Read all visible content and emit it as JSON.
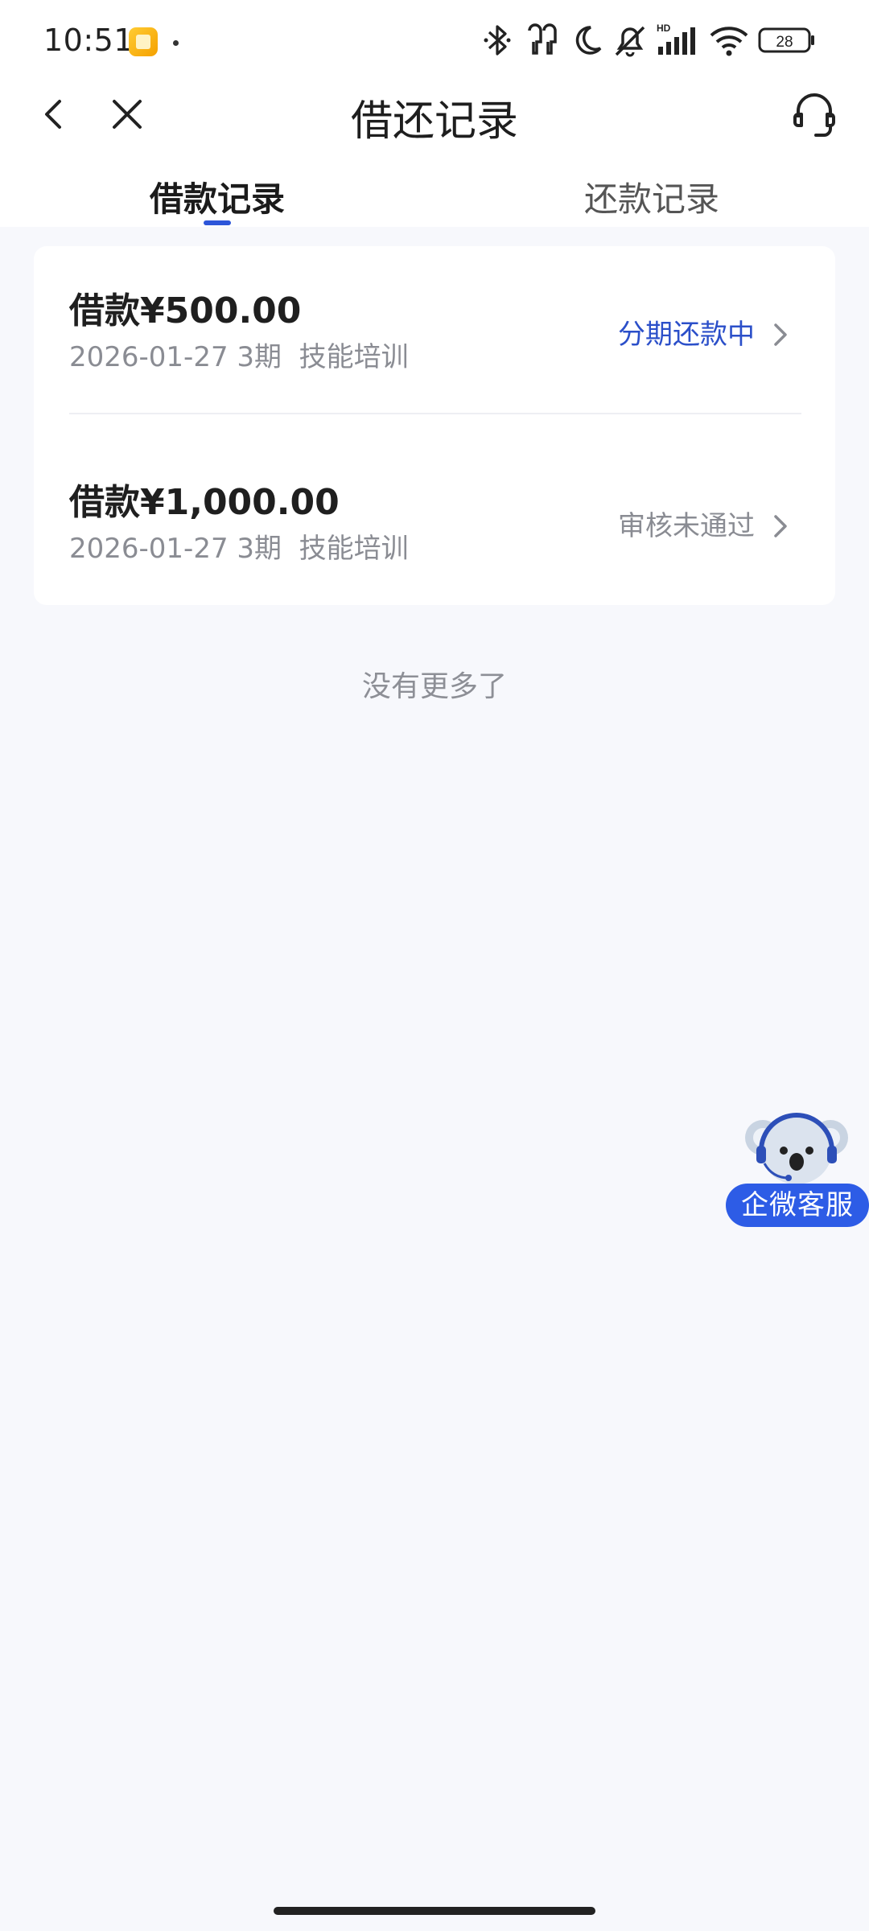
{
  "status_bar": {
    "time": "10:51",
    "battery": "28",
    "network_label": "HD",
    "icons": [
      "bluetooth-icon",
      "earbuds-icon",
      "moon-icon",
      "mute-bell-icon",
      "signal-icon",
      "wifi-icon",
      "battery-icon"
    ]
  },
  "nav": {
    "title": "借还记录",
    "back_icon": "chevron-left-icon",
    "close_icon": "close-icon",
    "service_icon": "headset-icon"
  },
  "tabs": [
    {
      "label": "借款记录",
      "active": true
    },
    {
      "label": "还款记录",
      "active": false
    }
  ],
  "records": [
    {
      "amount": "借款¥500.00",
      "meta": "2026-01-27 3期  技能培训",
      "status": "分期还款中",
      "status_color": "#2b4fc9"
    },
    {
      "amount": "借款¥1,000.00",
      "meta": "2026-01-27 3期  技能培训",
      "status": "审核未通过",
      "status_color": "#8a8c93"
    }
  ],
  "list_footer": "没有更多了",
  "float_service": {
    "label": "企微客服",
    "icon": "koala-mascot-icon"
  },
  "colors": {
    "accent": "#2c55d9",
    "background": "#f7f8fc"
  }
}
